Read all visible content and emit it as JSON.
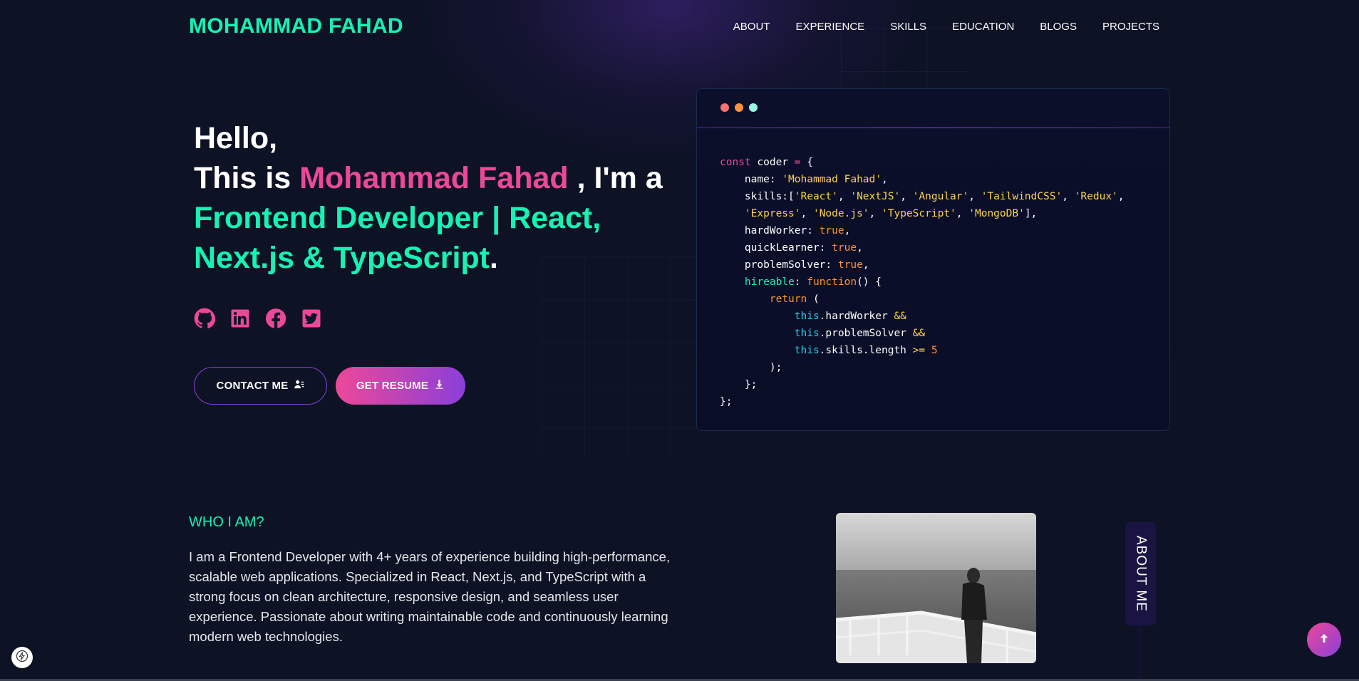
{
  "brand": "MOHAMMAD FAHAD",
  "nav": [
    "ABOUT",
    "EXPERIENCE",
    "SKILLS",
    "EDUCATION",
    "BLOGS",
    "PROJECTS"
  ],
  "hero": {
    "hello": "Hello,",
    "this_is": "This is ",
    "name": "Mohammad Fahad",
    "im_a": " , I'm a",
    "role": "Frontend Developer | React, Next.js & TypeScript",
    "period": "."
  },
  "socials": [
    "github-icon",
    "linkedin-icon",
    "facebook-icon",
    "twitter-icon"
  ],
  "buttons": {
    "contact": "CONTACT ME",
    "resume": "GET RESUME"
  },
  "code": {
    "dot_colors": [
      "#f87171",
      "#fb923c",
      "#99f6e4"
    ],
    "lines": [
      "const coder = {",
      "name: 'Mohammad Fahad',",
      "skills:['React', 'NextJS', 'Angular', 'TailwindCSS', 'Redux',",
      "'Express', 'Node.js', 'TypeScript', 'MongoDB'],",
      "hardWorker: true,",
      "quickLearner: true,",
      "problemSolver: true,",
      "hireable: function() {",
      "return (",
      "this.hardWorker &&",
      "this.problemSolver &&",
      "this.skills.length >= 5",
      ");",
      "};",
      "};"
    ]
  },
  "about": {
    "heading": "WHO I AM?",
    "text": "I am a Frontend Developer with 4+ years of experience building high-performance, scalable web applications. Specialized in React, Next.js, and TypeScript with a strong focus on clean architecture, responsive design, and seamless user experience. Passionate about writing maintainable code and continuously learning modern web technologies.",
    "tab": "ABOUT ME"
  },
  "colors": {
    "accent_green": "#16f2b3",
    "accent_pink": "#ec4899",
    "accent_purple": "#8b3fd9",
    "background": "#0d1224"
  }
}
